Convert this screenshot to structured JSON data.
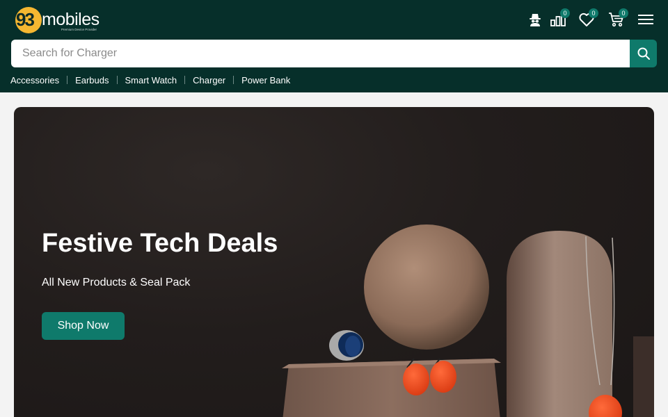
{
  "brand": {
    "logo_number": "93",
    "logo_word": "mobiles",
    "tagline": "Premium Device Provider"
  },
  "header_icons": [
    {
      "name": "spy-user-icon"
    },
    {
      "name": "compare-icon",
      "count": "0"
    },
    {
      "name": "heart-icon",
      "count": "0"
    },
    {
      "name": "cart-icon",
      "count": "0"
    },
    {
      "name": "menu-icon"
    }
  ],
  "search": {
    "placeholder": "Search for Charger",
    "value": ""
  },
  "categories": [
    "Accessories",
    "Earbuds",
    "Smart Watch",
    "Charger",
    "Power Bank"
  ],
  "hero": {
    "title": "Festive Tech Deals",
    "subtitle": "All New Products & Seal Pack",
    "cta": "Shop Now"
  },
  "colors": {
    "header_bg": "#062f2a",
    "accent": "#0f7a6b",
    "logo_yellow": "#f5b731",
    "page_bg": "#f3f3f3"
  }
}
